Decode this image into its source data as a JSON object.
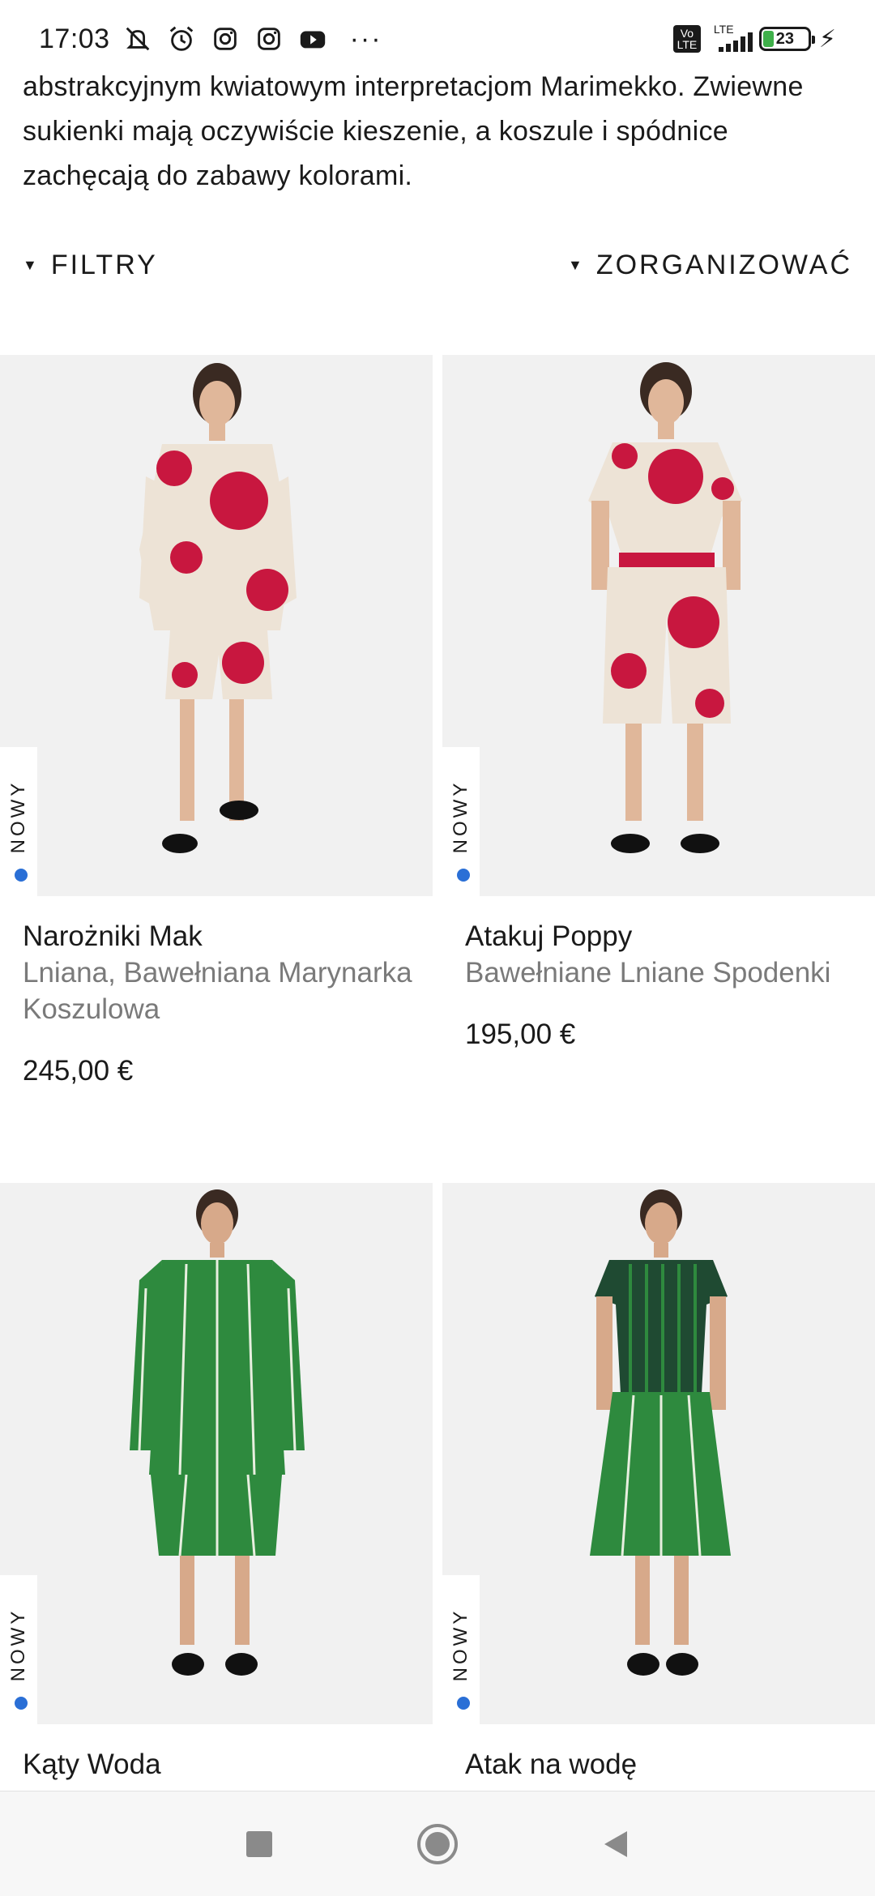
{
  "status_bar": {
    "time": "17:03",
    "icons": [
      "silent-mode-icon",
      "alarm-icon",
      "instagram-icon",
      "instagram-icon",
      "youtube-icon"
    ],
    "more": "···",
    "volte_label": "Vo LTE",
    "network_label": "LTE",
    "battery_level": "23",
    "battery_fraction": 0.23,
    "battery_color": "#3fb04a"
  },
  "intro": {
    "text": "abstrakcyjnym kwiatowym interpretacjom Marimekko. Zwiewne sukienki mają oczywiście kieszenie, a koszule i spódnice zachęcają do zabawy kolorami."
  },
  "toolbar": {
    "filters_label": "FILTRY",
    "sort_label": "ZORGANIZOWAĆ"
  },
  "products": [
    {
      "badge": "NOWY",
      "title": "Narożniki Mak",
      "subtitle": "Lniana, Bawełniana Marynarka Koszulowa",
      "price": "245,00 €",
      "colors": {
        "primary": "#c8173f",
        "secondary": "#ede3d6"
      }
    },
    {
      "badge": "NOWY",
      "title": "Atakuj Poppy",
      "subtitle": "Bawełniane Lniane Spodenki",
      "price": "195,00 €",
      "colors": {
        "primary": "#c8173f",
        "secondary": "#ede3d6"
      }
    },
    {
      "badge": "NOWY",
      "title": "Kąty Woda",
      "subtitle": "",
      "price": "",
      "colors": {
        "primary": "#2e8a3e",
        "secondary": "#e8efe0"
      }
    },
    {
      "badge": "NOWY",
      "title": "Atak na wodę",
      "subtitle": "",
      "price": "",
      "colors": {
        "primary": "#2e8a3e",
        "secondary": "#1f4a32"
      }
    }
  ],
  "accent": {
    "new_dot": "#2a6fd6"
  },
  "nav": {
    "icons": [
      "recents-square-icon",
      "home-circle-icon",
      "back-triangle-icon"
    ]
  }
}
